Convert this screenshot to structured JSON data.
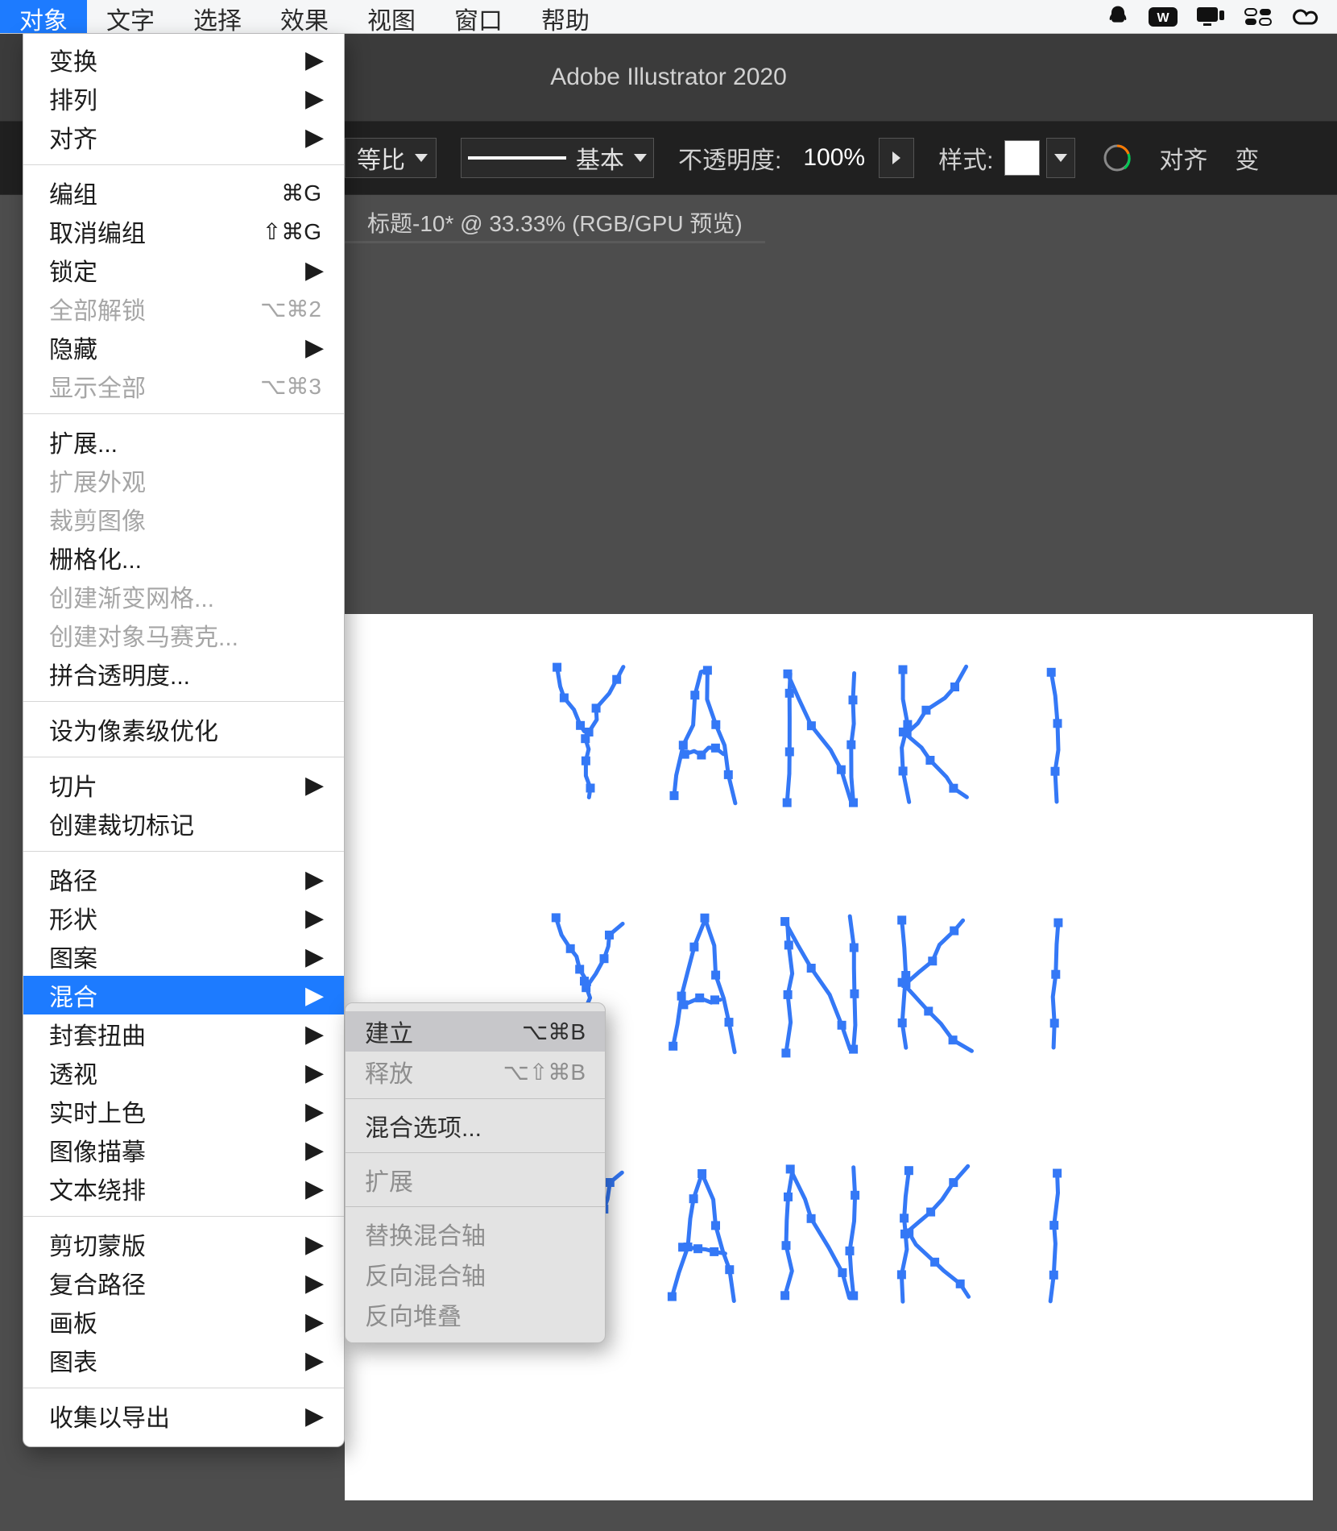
{
  "menubar": {
    "items": [
      "对象",
      "文字",
      "选择",
      "效果",
      "视图",
      "窗口",
      "帮助"
    ],
    "active_index": 0,
    "tray_icons": [
      "qq-icon",
      "wps-icon",
      "display-icon",
      "control-center-icon",
      "creative-cloud-icon"
    ]
  },
  "titlebar": {
    "app_name": "Adobe Illustrator 2020"
  },
  "controlbar": {
    "scale_mode": "等比",
    "stroke_style": "基本",
    "opacity_label": "不透明度:",
    "opacity_value": "100%",
    "style_label": "样式:",
    "align_label": "对齐",
    "transform_label": "变"
  },
  "docbar": {
    "tab_title_prefix": "标题-10* @ 33.33% (RGB/GPU 预览)"
  },
  "canvas": {
    "word": "YANKI"
  },
  "menu": {
    "groups": [
      [
        {
          "label": "变换",
          "arrow": true
        },
        {
          "label": "排列",
          "arrow": true
        },
        {
          "label": "对齐",
          "arrow": true
        }
      ],
      [
        {
          "label": "编组",
          "shortcut": "⌘G"
        },
        {
          "label": "取消编组",
          "shortcut": "⇧⌘G"
        },
        {
          "label": "锁定",
          "arrow": true
        },
        {
          "label": "全部解锁",
          "shortcut": "⌥⌘2",
          "disabled": true
        },
        {
          "label": "隐藏",
          "arrow": true
        },
        {
          "label": "显示全部",
          "shortcut": "⌥⌘3",
          "disabled": true
        }
      ],
      [
        {
          "label": "扩展..."
        },
        {
          "label": "扩展外观",
          "disabled": true
        },
        {
          "label": "裁剪图像",
          "disabled": true
        },
        {
          "label": "栅格化..."
        },
        {
          "label": "创建渐变网格...",
          "disabled": true
        },
        {
          "label": "创建对象马赛克...",
          "disabled": true
        },
        {
          "label": "拼合透明度..."
        }
      ],
      [
        {
          "label": "设为像素级优化"
        }
      ],
      [
        {
          "label": "切片",
          "arrow": true
        },
        {
          "label": "创建裁切标记"
        }
      ],
      [
        {
          "label": "路径",
          "arrow": true
        },
        {
          "label": "形状",
          "arrow": true
        },
        {
          "label": "图案",
          "arrow": true
        },
        {
          "label": "混合",
          "arrow": true,
          "highlight": true
        },
        {
          "label": "封套扭曲",
          "arrow": true
        },
        {
          "label": "透视",
          "arrow": true
        },
        {
          "label": "实时上色",
          "arrow": true
        },
        {
          "label": "图像描摹",
          "arrow": true
        },
        {
          "label": "文本绕排",
          "arrow": true
        }
      ],
      [
        {
          "label": "剪切蒙版",
          "arrow": true
        },
        {
          "label": "复合路径",
          "arrow": true
        },
        {
          "label": "画板",
          "arrow": true
        },
        {
          "label": "图表",
          "arrow": true
        }
      ],
      [
        {
          "label": "收集以导出",
          "arrow": true
        }
      ]
    ]
  },
  "submenu": {
    "groups": [
      [
        {
          "label": "建立",
          "shortcut": "⌥⌘B",
          "highlight": true
        },
        {
          "label": "释放",
          "shortcut": "⌥⇧⌘B",
          "disabled": true
        }
      ],
      [
        {
          "label": "混合选项..."
        }
      ],
      [
        {
          "label": "扩展",
          "disabled": true
        }
      ],
      [
        {
          "label": "替换混合轴",
          "disabled": true
        },
        {
          "label": "反向混合轴",
          "disabled": true
        },
        {
          "label": "反向堆叠",
          "disabled": true
        }
      ]
    ]
  }
}
